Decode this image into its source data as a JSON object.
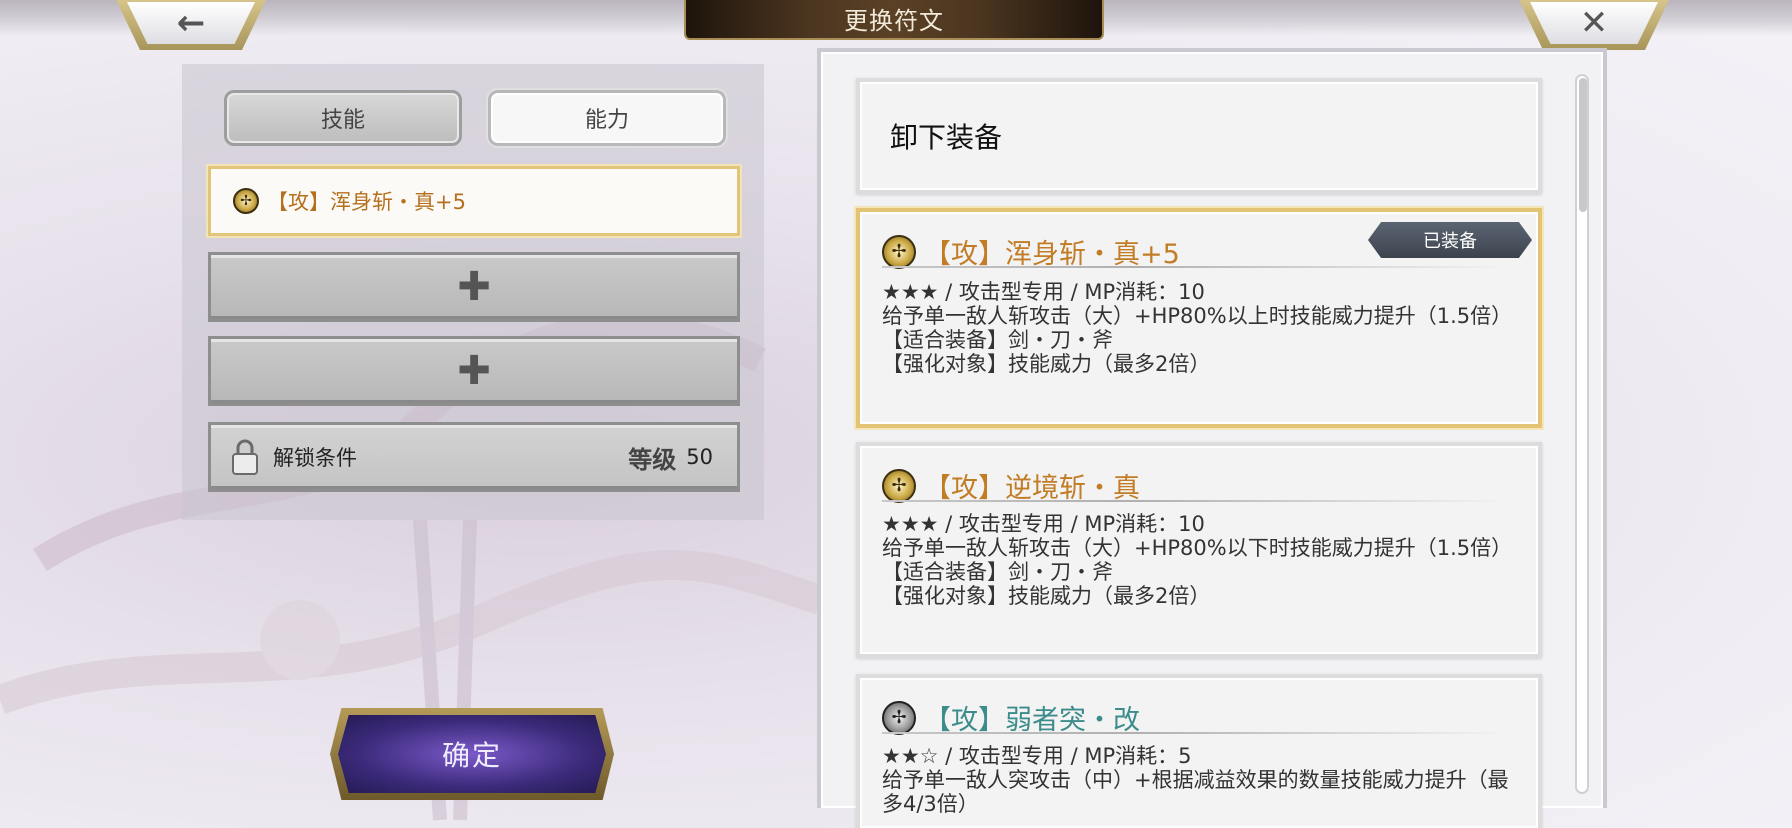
{
  "header": {
    "title": "更换符文",
    "back_icon": "←",
    "close_icon": "✕"
  },
  "left": {
    "tabs": [
      {
        "label": "技能"
      },
      {
        "label": "能力"
      }
    ],
    "slots": [
      {
        "label": "【攻】浑身斩・真+5",
        "icon": "rune-gold"
      },
      {
        "icon": "plus",
        "glyph": "✚"
      },
      {
        "icon": "plus",
        "glyph": "✚"
      }
    ],
    "lock": {
      "label": "解锁条件",
      "level_label": "等级",
      "level_value": "50"
    },
    "confirm_label": "确定"
  },
  "list": {
    "unequip_label": "卸下装备",
    "runes": [
      {
        "name": "【攻】浑身斩・真+5",
        "badge": "已装备",
        "icon": "rune-gold",
        "meta": "★★★ / 攻击型专用 / MP消耗：10",
        "desc": "给予单一敌人斩攻击（大）+HP80%以上时技能威力提升（1.5倍）",
        "equip": "【适合装备】剑・刀・斧",
        "enhance": "【强化对象】技能威力（最多2倍）"
      },
      {
        "name": "【攻】逆境斩・真",
        "icon": "rune-gold",
        "meta": "★★★ / 攻击型专用 / MP消耗：10",
        "desc": "给予单一敌人斩攻击（大）+HP80%以下时技能威力提升（1.5倍）",
        "equip": "【适合装备】剑・刀・斧",
        "enhance": "【强化对象】技能威力（最多2倍）"
      },
      {
        "name": "【攻】弱者突・改",
        "icon": "rune-silver",
        "meta": "★★☆ / 攻击型专用 / MP消耗：5",
        "desc": "给予单一敌人突攻击（中）+根据减益效果的数量技能威力提升（最多4/3倍）"
      }
    ]
  },
  "colors": {
    "accent_gold": "#e3c474",
    "rune_name_orange": "#c27c25",
    "rune_name_teal": "#3c8c8c",
    "confirm_purple": "#3b2a7a"
  }
}
